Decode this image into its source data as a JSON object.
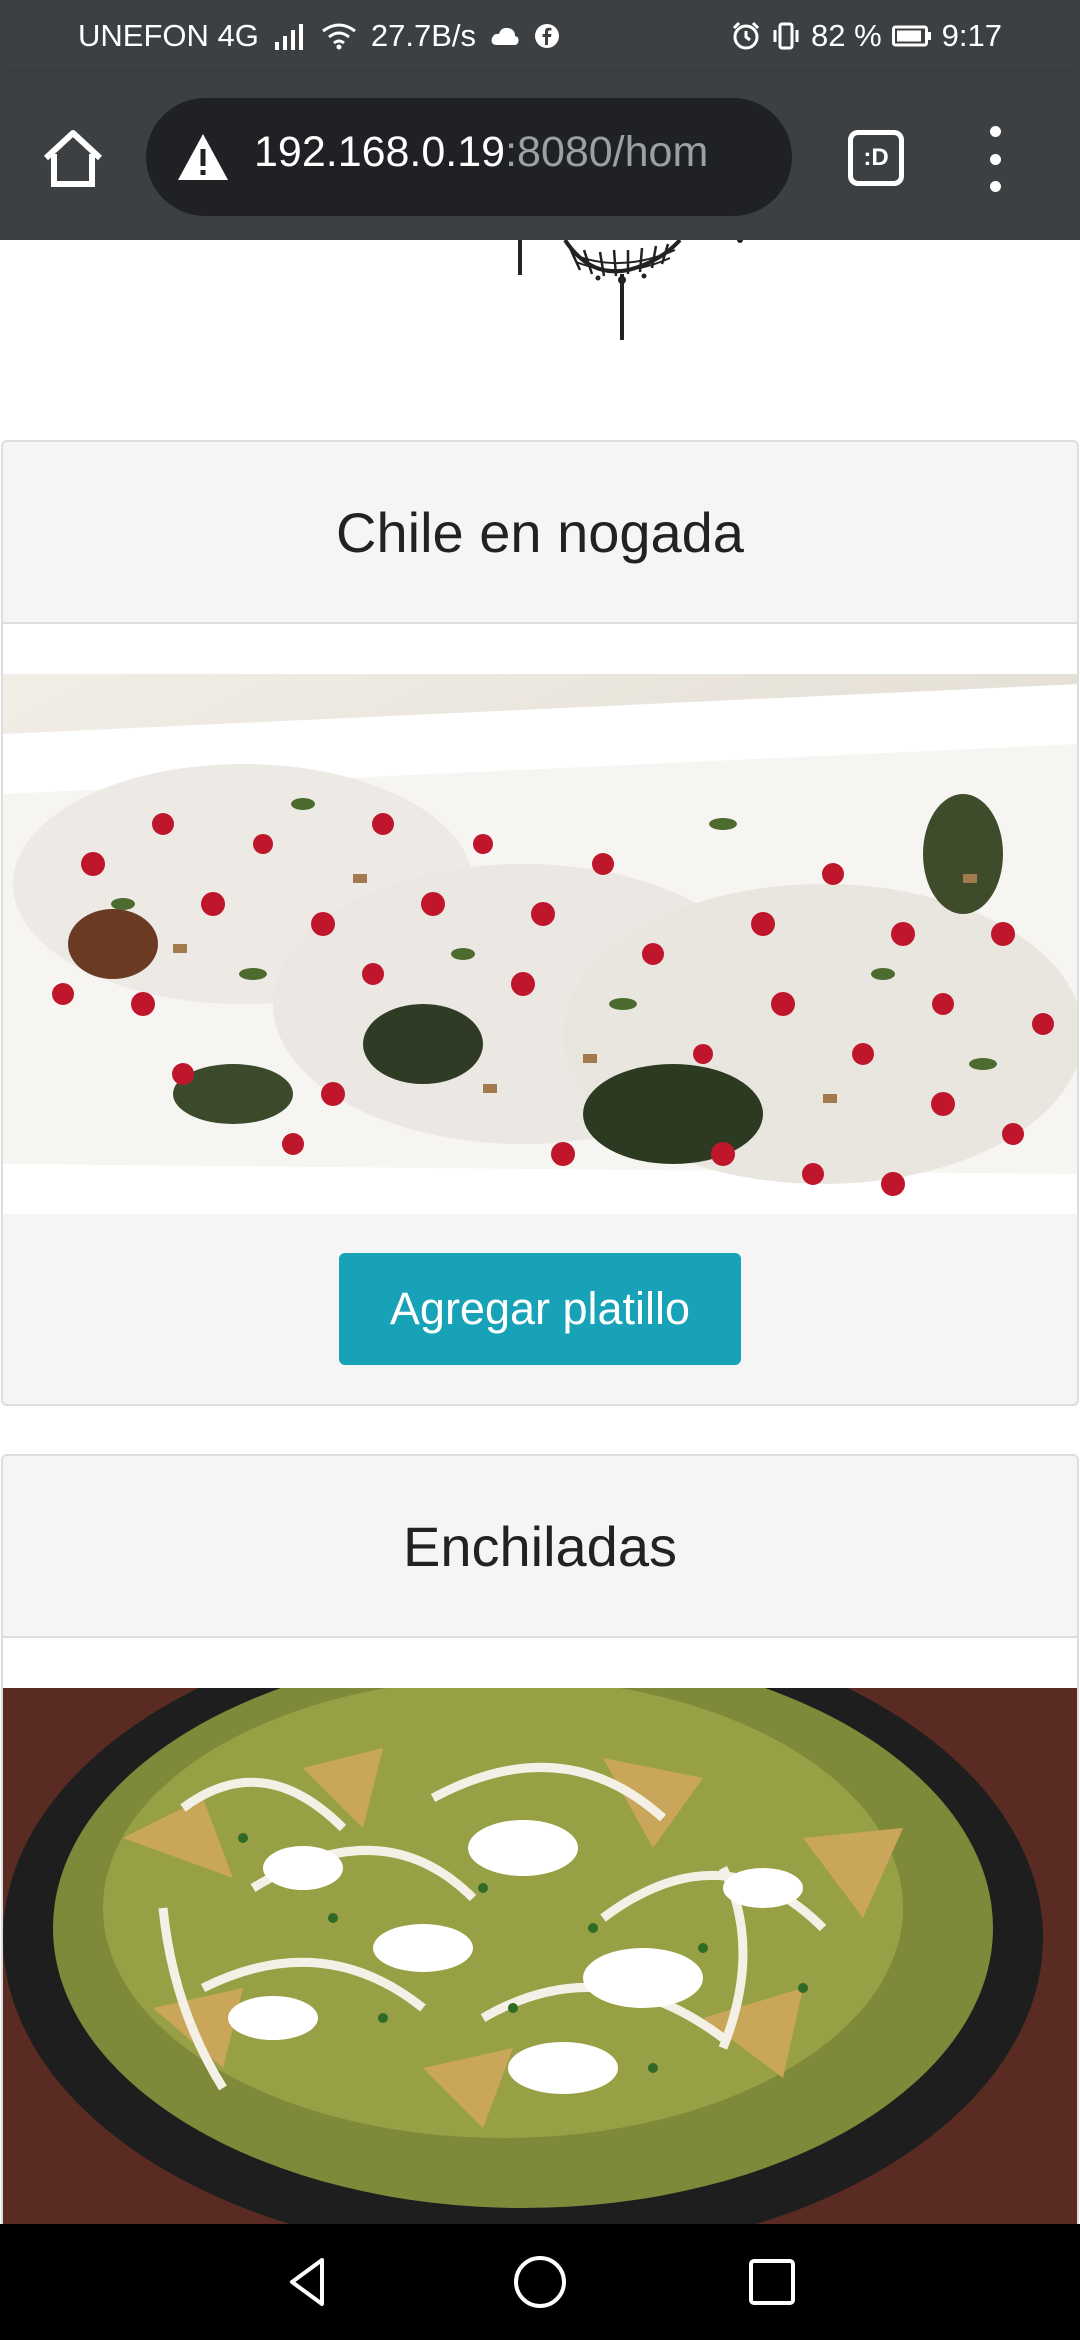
{
  "status_bar": {
    "carrier": "UNEFON 4G",
    "speed": "27.7B/s",
    "battery": "82 %",
    "time": "9:17",
    "icons": [
      "signal-icon",
      "wifi-icon",
      "cloud-icon",
      "facebook-icon",
      "alarm-icon",
      "vibrate-icon",
      "battery-icon"
    ]
  },
  "browser": {
    "url_host": "192.168.0.19",
    "url_rest": ":8080/hom",
    "tab_switcher_label": ":D",
    "icons": [
      "home-icon",
      "warning-icon",
      "menu-icon"
    ]
  },
  "dishes": [
    {
      "name": "Chile en nogada",
      "button_label": "Agregar platillo"
    },
    {
      "name": "Enchiladas"
    }
  ],
  "colors": {
    "toolbar": "#3c4043",
    "url_box": "#202124",
    "button": "#17a2b8",
    "card_bg": "#f5f5f5",
    "card_border": "#dddddd"
  }
}
